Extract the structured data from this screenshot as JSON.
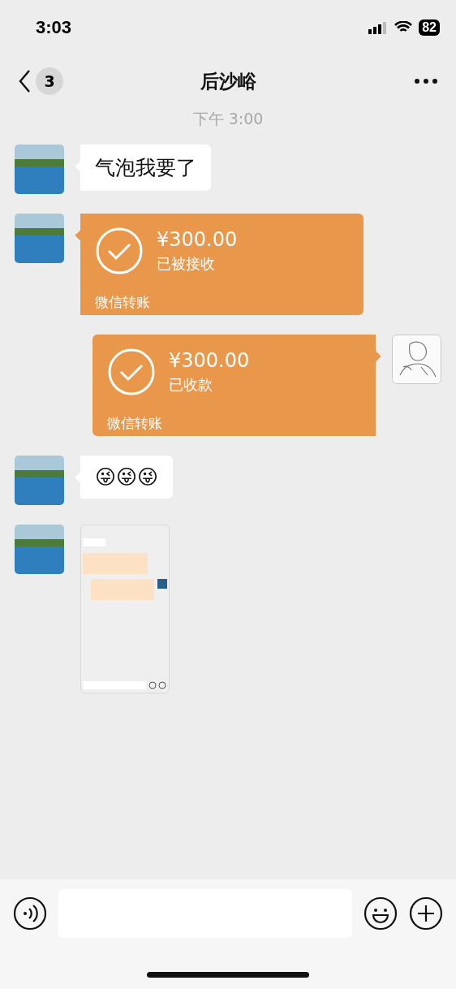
{
  "status_bar": {
    "time": "3:03",
    "battery": "82"
  },
  "header": {
    "back_badge": "3",
    "title": "后沙峪"
  },
  "timestamp": "下午 3:00",
  "messages": [
    {
      "kind": "text",
      "outgoing": false,
      "text": "气泡我要了"
    },
    {
      "kind": "transfer",
      "outgoing": false,
      "amount": "¥300.00",
      "status": "已被接收",
      "caption": "微信转账"
    },
    {
      "kind": "transfer",
      "outgoing": true,
      "amount": "¥300.00",
      "status": "已收款",
      "caption": "微信转账"
    },
    {
      "kind": "emoji",
      "outgoing": false,
      "text": "😜😜😜"
    },
    {
      "kind": "image",
      "outgoing": false
    }
  ]
}
